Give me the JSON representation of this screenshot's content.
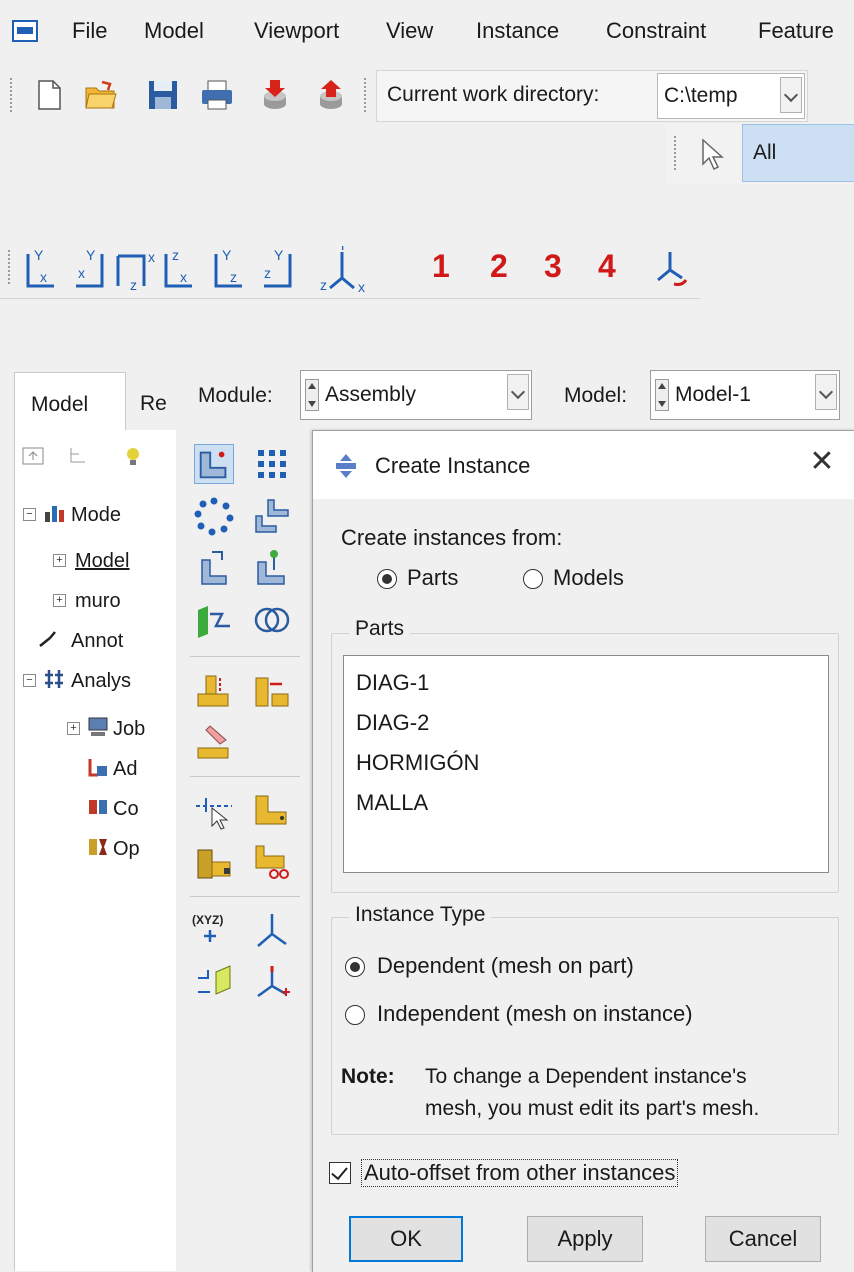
{
  "menubar": {
    "items": [
      "File",
      "Model",
      "Viewport",
      "View",
      "Instance",
      "Constraint",
      "Feature"
    ]
  },
  "toolbar": {
    "cwd_label": "Current work directory:",
    "cwd_value": "C:\\temp",
    "icons": [
      "new-file-icon",
      "open-folder-icon",
      "save-icon",
      "print-icon",
      "import-icon",
      "export-icon"
    ]
  },
  "selection": {
    "filter_value": "All"
  },
  "view_toolbar": {
    "numbers": [
      "1",
      "2",
      "3",
      "4"
    ],
    "accent": "#d01a1a"
  },
  "tree_tabs": {
    "model": "Model",
    "results": "Re"
  },
  "tree": {
    "items": [
      "Mode",
      "Model",
      "muro",
      "Annot",
      "Analys",
      "Job",
      "Ad",
      "Co",
      "Op"
    ]
  },
  "module_bar": {
    "module_label": "Module:",
    "module_value": "Assembly",
    "model_label": "Model:",
    "model_value": "Model-1"
  },
  "dialog": {
    "title": "Create Instance",
    "close": "✕",
    "create_from_label": "Create instances from:",
    "source_options": [
      "Parts",
      "Models"
    ],
    "source_selected": "Parts",
    "parts_group_label": "Parts",
    "parts": [
      "DIAG-1",
      "DIAG-2",
      "HORMIGÓN",
      "MALLA"
    ],
    "instance_type_label": "Instance Type",
    "instance_types": [
      "Dependent (mesh on part)",
      "Independent (mesh on instance)"
    ],
    "instance_type_selected": "Dependent (mesh on part)",
    "note_label": "Note:",
    "note_line1": "To change a Dependent instance's",
    "note_line2": "mesh, you must edit its part's mesh.",
    "auto_offset_label": "Auto-offset from other instances",
    "auto_offset_checked": true,
    "buttons": {
      "ok": "OK",
      "apply": "Apply",
      "cancel": "Cancel"
    }
  }
}
